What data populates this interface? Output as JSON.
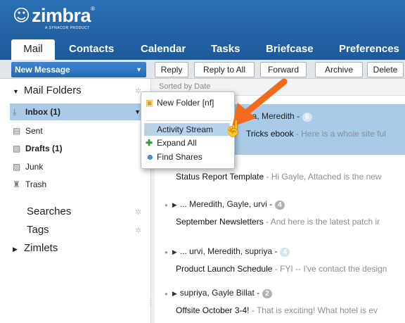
{
  "brand": {
    "name": "zimbra",
    "reg_mark": "®",
    "subtitle": "A SYNACOR PRODUCT",
    "color": "#1f5fa1"
  },
  "tabs": [
    {
      "label": "Mail",
      "active": true
    },
    {
      "label": "Contacts"
    },
    {
      "label": "Calendar"
    },
    {
      "label": "Tasks"
    },
    {
      "label": "Briefcase"
    },
    {
      "label": "Preferences"
    }
  ],
  "toolbar": {
    "new_message": "New Message",
    "reply": "Reply",
    "reply_all": "Reply to All",
    "forward": "Forward",
    "archive": "Archive",
    "delete": "Delete"
  },
  "sidebar": {
    "mail_folders": "Mail Folders",
    "folders": [
      {
        "label": "Inbox (1)",
        "icon": "inbox-icon",
        "bold": true,
        "selected": true
      },
      {
        "label": "Sent",
        "icon": "sent-icon"
      },
      {
        "label": "Drafts (1)",
        "icon": "drafts-icon",
        "bold": true
      },
      {
        "label": "Junk",
        "icon": "junk-icon"
      },
      {
        "label": "Trash",
        "icon": "trash-icon"
      }
    ],
    "searches": "Searches",
    "tags": "Tags",
    "zimlets": "Zimlets"
  },
  "context_menu": {
    "items": [
      {
        "label": "New Folder [nf]",
        "icon": "new-folder-icon"
      },
      {
        "label": "Activity Stream",
        "icon": "activity-stream-icon",
        "highlighted": true
      },
      {
        "label": "Expand All",
        "icon": "expand-all-icon"
      },
      {
        "label": "Find Shares",
        "icon": "find-shares-icon"
      }
    ]
  },
  "messages": [
    {
      "participants": "iya, Meredith -",
      "count": "6",
      "subject": "Tricks ebook",
      "fragment": " - Here is a whole site ful"
    },
    {
      "participants": "",
      "count": "",
      "subject": "Status Report Template",
      "fragment": " - Hi Gayle, Attached is the new"
    },
    {
      "participants": "... Meredith, Gayle, urvi -",
      "count": "4",
      "subject": "September Newsletters",
      "fragment": " - And here is the latest patch ir"
    },
    {
      "participants": "... urvi, Meredith, supriya -",
      "count": "4",
      "subject": "Product Launch Schedule",
      "fragment": " - FYI -- I've contact the design"
    },
    {
      "participants": "supriya, Gayle Billat -",
      "count": "2",
      "subject": "Offsite October 3-4!",
      "fragment": " - That is exciting! What hotel is ev"
    }
  ],
  "sort_label": "Sorted by Date",
  "colors": {
    "accent": "#2a6fb4",
    "selection": "#a9cbe8",
    "arrow": "#f26a1b"
  }
}
